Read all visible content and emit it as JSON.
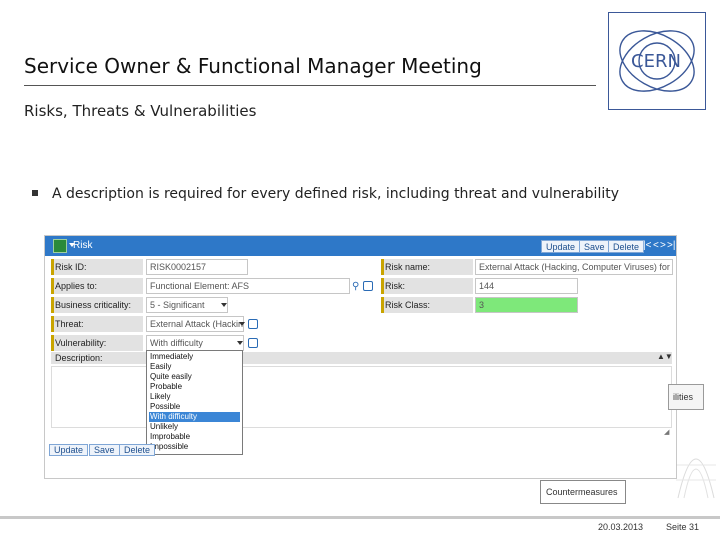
{
  "slide": {
    "title": "Service Owner & Functional Manager Meeting",
    "subtitle": "Risks, Threats & Vulnerabilities",
    "bullet": "A description is required for every defined risk, including threat and vulnerability",
    "logo_text": "CERN"
  },
  "toolbar": {
    "title": "Risk",
    "buttons": [
      "Update",
      "Save",
      "Delete"
    ],
    "nav": [
      "|<",
      "<",
      ">",
      ">|"
    ]
  },
  "form": {
    "risk_id_label": "Risk ID:",
    "risk_id_value": "RISK0002157",
    "applies_to_label": "Applies to:",
    "applies_to_value": "Functional Element: AFS",
    "business_criticality_label": "Business criticality:",
    "business_criticality_value": "5 - Significant",
    "threat_label": "Threat:",
    "threat_value": "External Attack (Hackin",
    "vulnerability_label": "Vulnerability:",
    "vulnerability_value": "With difficulty",
    "description_label": "Description:",
    "risk_name_label": "Risk name:",
    "risk_name_value": "External Attack (Hacking, Computer Viruses) for AFS",
    "risk_label": "Risk:",
    "risk_value": "144",
    "risk_class_label": "Risk Class:",
    "risk_class_value": "3"
  },
  "dropdown": {
    "options": [
      "Immediately",
      "Easily",
      "Quite easily",
      "Probable",
      "Likely",
      "Possible",
      "With difficulty",
      "Unlikely",
      "Improbable",
      "Impossible"
    ],
    "selected": "With difficulty"
  },
  "bottom_buttons": [
    "Update",
    "Save",
    "Delete"
  ],
  "overlay": {
    "partial_label": "ilities",
    "countermeasures": "Countermeasures"
  },
  "footer": {
    "date": "20.03.2013",
    "page": "Seite 31"
  },
  "colors": {
    "toolbar": "#2e78c8",
    "risk_class_fill": "#7ee87a",
    "selected_option": "#3b86d6",
    "logo": "#3b5898"
  }
}
